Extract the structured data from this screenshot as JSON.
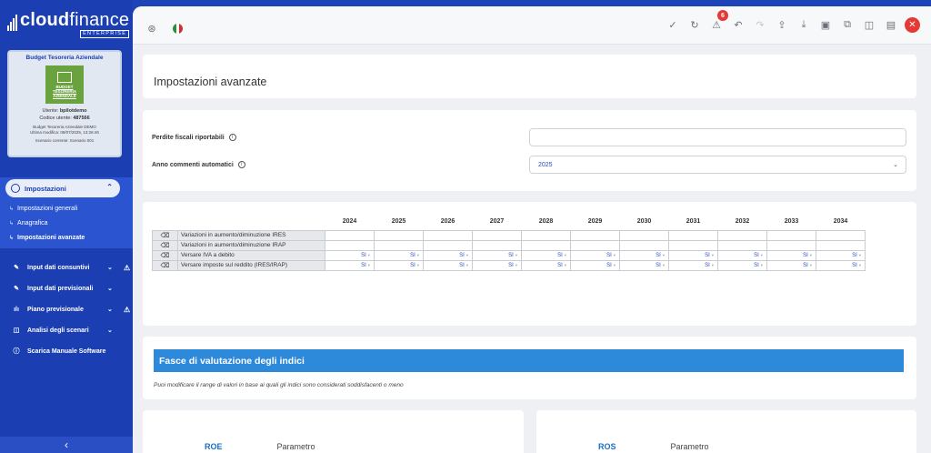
{
  "brand": {
    "name_bold": "cloud",
    "name_light": "finance",
    "tagline": "ENTERPRISE"
  },
  "profile": {
    "title": "Budget Tesoreria Aziendale",
    "image_text": "BUDGET TESORERIA AZIENDALE",
    "user_label": "Utente:",
    "user_value": "bpilotdemo",
    "code_label": "Codice utente:",
    "code_value": "487566",
    "company": "Budget Tesoreria Aziendale DEMO",
    "last_modified": "Ultima modifica: 08/07/2025, 13:26:46",
    "scenario": "Scenario corrente: Scenario 001"
  },
  "sidebar": {
    "section": "Impostazioni",
    "sub_items": [
      {
        "label": "Impostazioni generali"
      },
      {
        "label": "Anagrafica"
      },
      {
        "label": "Impostazioni avanzate"
      }
    ],
    "items": [
      {
        "label": "Input dati consuntivi"
      },
      {
        "label": "Input dati previsionali"
      },
      {
        "label": "Piano previsionale"
      },
      {
        "label": "Analisi degli scenari"
      },
      {
        "label": "Scarica Manuale Software"
      }
    ]
  },
  "toolbar": {
    "notification_count": "6"
  },
  "page": {
    "title": "Impostazioni avanzate"
  },
  "form": {
    "fiscal_losses_label": "Perdite fiscali riportabili",
    "fiscal_losses_value": "",
    "auto_comments_label": "Anno commenti automatici",
    "auto_comments_value": "2025"
  },
  "grid": {
    "years": [
      "2024",
      "2025",
      "2026",
      "2027",
      "2028",
      "2029",
      "2030",
      "2031",
      "2032",
      "2033",
      "2034"
    ],
    "rows": [
      {
        "label": "Variazioni in aumento/diminuzione IRES",
        "values": [
          "",
          "",
          "",
          "",
          "",
          "",
          "",
          "",
          "",
          "",
          ""
        ]
      },
      {
        "label": "Variazioni in aumento/diminuzione IRAP",
        "values": [
          "",
          "",
          "",
          "",
          "",
          "",
          "",
          "",
          "",
          "",
          ""
        ]
      },
      {
        "label": "Versare IVA a debito",
        "values": [
          "SI",
          "SI",
          "SI",
          "SI",
          "SI",
          "SI",
          "SI",
          "SI",
          "SI",
          "SI",
          "SI"
        ]
      },
      {
        "label": "Versare imposte sul reddito (IRES/IRAP)",
        "values": [
          "SI",
          "SI",
          "SI",
          "SI",
          "SI",
          "SI",
          "SI",
          "SI",
          "SI",
          "SI",
          "SI"
        ]
      }
    ]
  },
  "valuation": {
    "title": "Fasce di valutazione degli indici",
    "description": "Puoi modificare il range di valori in base ai quali gli indici sono considerati soddisfacenti o meno",
    "left": {
      "key": "ROE",
      "label": "Parametro"
    },
    "right": {
      "key": "ROS",
      "label": "Parametro"
    }
  }
}
